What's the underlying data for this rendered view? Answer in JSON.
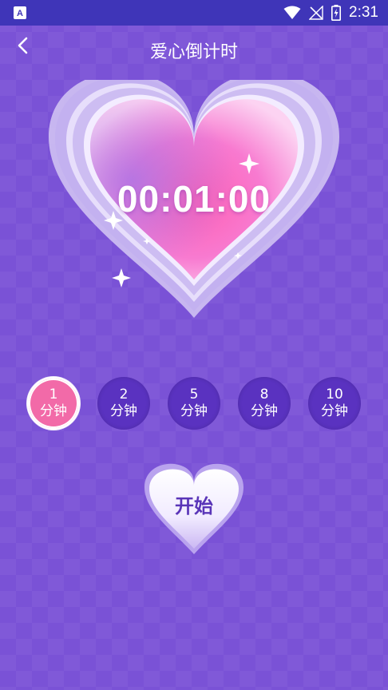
{
  "status_bar": {
    "time": "2:31",
    "left_icon": "a-text-icon",
    "icons": [
      "wifi-icon",
      "no-signal-icon",
      "battery-charging-icon"
    ]
  },
  "header": {
    "title": "爱心倒计时",
    "back_icon": "chevron-left-icon"
  },
  "timer": {
    "display": "00:01:00"
  },
  "durations": [
    {
      "value": "1",
      "unit": "分钟",
      "selected": true
    },
    {
      "value": "2",
      "unit": "分钟",
      "selected": false
    },
    {
      "value": "5",
      "unit": "分钟",
      "selected": false
    },
    {
      "value": "8",
      "unit": "分钟",
      "selected": false
    },
    {
      "value": "10",
      "unit": "分钟",
      "selected": false
    }
  ],
  "start_button": {
    "label": "开始"
  },
  "colors": {
    "background": "#7a52d6",
    "status_bar": "#3f35b8",
    "accent_pink": "#f26aa8",
    "option_bg": "#5a32c0"
  }
}
